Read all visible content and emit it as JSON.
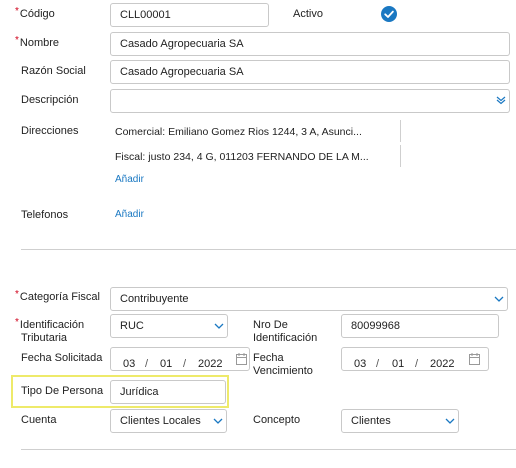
{
  "codigo": {
    "label": "Código",
    "value": "CLL00001"
  },
  "activo": {
    "label": "Activo",
    "checked": true
  },
  "nombre": {
    "label": "Nombre",
    "value": "Casado Agropecuaria SA"
  },
  "razon_social": {
    "label": "Razón Social",
    "value": "Casado Agropecuaria SA"
  },
  "descripcion": {
    "label": "Descripción",
    "value": ""
  },
  "direcciones": {
    "label": "Direcciones",
    "items": [
      "Comercial: Emiliano Gomez Rios 1244, 3 A, Asunci...",
      "Fiscal: justo 234, 4 G, 011203 FERNANDO DE LA M..."
    ],
    "add_label": "Añadir"
  },
  "telefonos": {
    "label": "Telefonos",
    "add_label": "Añadir"
  },
  "categoria_fiscal": {
    "label": "Categoría Fiscal",
    "value": "Contribuyente"
  },
  "identificacion_tributaria": {
    "label_line1": "Identificación",
    "label_line2": "Tributaria",
    "value": "RUC"
  },
  "nro_identificacion": {
    "label_line1": "Nro De",
    "label_line2": "Identificación",
    "value": "80099968"
  },
  "fecha_solicitada": {
    "label": "Fecha Solicitada",
    "day": "03",
    "month": "01",
    "year": "2022"
  },
  "fecha_vencimiento": {
    "label_line1": "Fecha",
    "label_line2": "Vencimiento",
    "day": "03",
    "month": "01",
    "year": "2022"
  },
  "tipo_persona": {
    "label": "Tipo De Persona",
    "value": "Jurídica"
  },
  "cuenta": {
    "label": "Cuenta",
    "value": "Clientes Locales"
  },
  "concepto": {
    "label": "Concepto",
    "value": "Clientes"
  },
  "colors": {
    "accent": "#1a78c2",
    "required": "#d0021b",
    "highlight": "#eeea6a"
  }
}
